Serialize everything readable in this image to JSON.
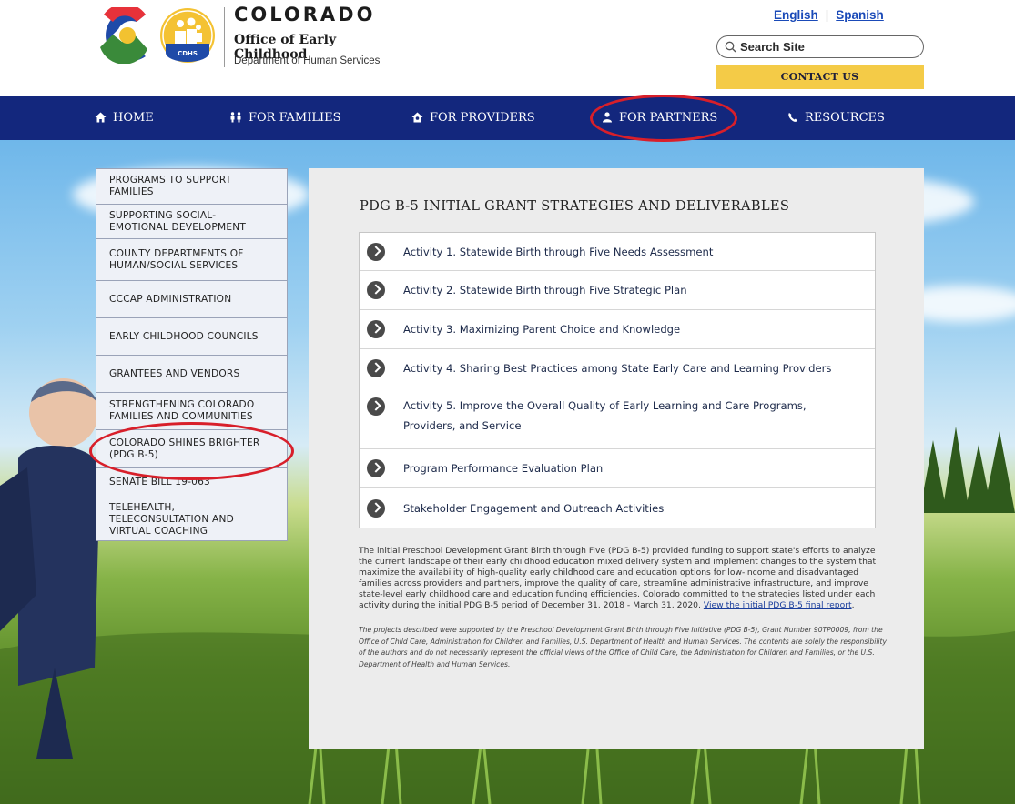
{
  "header": {
    "org_name": "COLORADO",
    "office": "Office of Early Childhood",
    "department": "Department of Human Services",
    "cdhs_badge": "CDHS",
    "lang_english": "English",
    "lang_sep": "|",
    "lang_spanish": "Spanish",
    "search_placeholder": "Search Site",
    "contact_label": "CONTACT US"
  },
  "nav": {
    "items": [
      {
        "label": "HOME",
        "icon": "home-icon"
      },
      {
        "label": "FOR FAMILIES",
        "icon": "family-icon"
      },
      {
        "label": "FOR PROVIDERS",
        "icon": "provider-icon"
      },
      {
        "label": "FOR PARTNERS",
        "icon": "partner-icon"
      },
      {
        "label": "RESOURCES",
        "icon": "resources-icon"
      }
    ]
  },
  "sidebar": {
    "items": [
      {
        "label": "PROGRAMS TO SUPPORT FAMILIES"
      },
      {
        "label": "SUPPORTING SOCIAL-EMOTIONAL DEVELOPMENT"
      },
      {
        "label": "COUNTY DEPARTMENTS OF HUMAN/SOCIAL SERVICES"
      },
      {
        "label": "CCCAP ADMINISTRATION"
      },
      {
        "label": "EARLY CHILDHOOD COUNCILS"
      },
      {
        "label": "GRANTEES AND VENDORS"
      },
      {
        "label": "STRENGTHENING COLORADO FAMILIES AND COMMUNITIES"
      },
      {
        "label": "COLORADO SHINES BRIGHTER (PDG B-5)"
      },
      {
        "label": "SENATE BILL 19-063"
      },
      {
        "label": "TELEHEALTH, TELECONSULTATION AND VIRTUAL COACHING"
      }
    ]
  },
  "main": {
    "title": "PDG B-5 INITIAL GRANT STRATEGIES AND DELIVERABLES",
    "activities": [
      {
        "label": "Activity 1. Statewide Birth through Five Needs Assessment"
      },
      {
        "label": "Activity 2. Statewide Birth through Five Strategic Plan"
      },
      {
        "label": "Activity 3. Maximizing Parent Choice and Knowledge"
      },
      {
        "label": "Activity 4. Sharing Best Practices among State Early Care and Learning Providers"
      },
      {
        "label": "Activity 5. Improve the Overall Quality of Early Learning and Care Programs, Providers, and Service"
      },
      {
        "label": "Program Performance Evaluation Plan"
      },
      {
        "label": "Stakeholder Engagement and Outreach Activities"
      }
    ],
    "description": "The initial Preschool Development Grant Birth through Five (PDG B-5) provided funding to support state's efforts to analyze the current landscape of their early childhood education mixed delivery system and implement changes to the system that maximize the availability of high-quality early childhood care and education options for low-income and disadvantaged families across providers and partners, improve the quality of care, streamline administrative infrastructure, and improve state-level early childhood care and education funding efficiencies. Colorado committed to the strategies listed under each activity during the initial PDG B-5 period of December 31, 2018 - March 31, 2020.",
    "report_link": "View the initial PDG B-5 final report",
    "report_suffix": ".",
    "disclaimer": "The projects described were supported by the Preschool Development Grant Birth through Five Initiative (PDG B-5), Grant Number 90TP0009, from the Office of Child Care, Administration for Children and Families, U.S. Department of Health and Human Services. The contents are solely the responsibility of the authors and do not necessarily represent the official views of the Office of Child Care, the Administration for Children and Families, or the U.S. Department of Health and Human Services."
  },
  "colors": {
    "nav_bg": "#13277d",
    "contact_bg": "#f4cb47",
    "annotation_ring": "#d81f2a",
    "link": "#1a4ab8"
  }
}
